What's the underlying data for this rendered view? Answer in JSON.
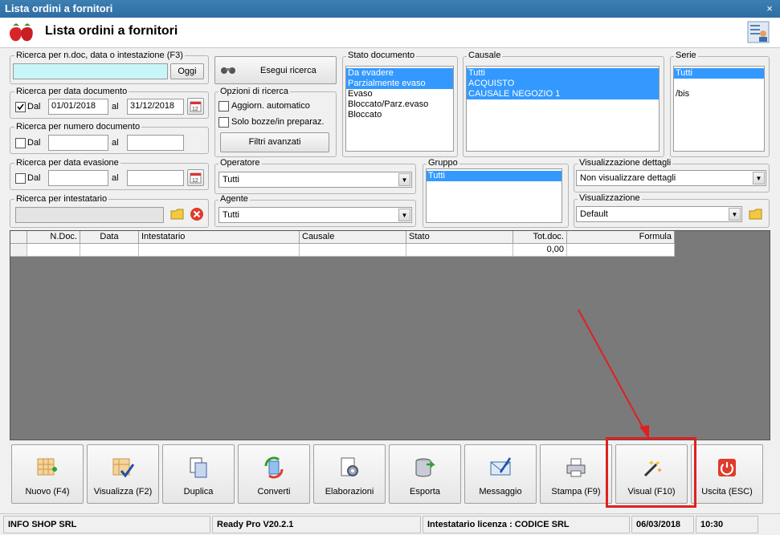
{
  "window": {
    "title": "Lista ordini a fornitori",
    "close": "×"
  },
  "header": {
    "title": "Lista ordini a fornitori"
  },
  "search_ndoc": {
    "label": "Ricerca per n.doc, data o intestazione (F3)",
    "value": "",
    "today_button": "Oggi"
  },
  "search_button": "Esegui ricerca",
  "search_date": {
    "label": "Ricerca per data documento",
    "checked": true,
    "dal_label": "Dal",
    "from": "01/01/2018",
    "al_label": "al",
    "to": "31/12/2018"
  },
  "search_number": {
    "label": "Ricerca per numero documento",
    "dal_label": "Dal",
    "al_label": "al",
    "from": "",
    "to": ""
  },
  "search_evasion": {
    "label": "Ricerca per data evasione",
    "dal_label": "Dal",
    "al_label": "al",
    "from": "",
    "to": ""
  },
  "search_holder": {
    "label": "Ricerca per intestatario",
    "value": ""
  },
  "options": {
    "label": "Opzioni di ricerca",
    "auto_refresh": "Aggiorn. automatico",
    "drafts_only": "Solo bozze/in preparaz.",
    "advanced_filters": "Filtri avanzati"
  },
  "stato": {
    "label": "Stato documento",
    "items": [
      {
        "text": "Da evadere",
        "selected": true
      },
      {
        "text": "Parzialmente evaso",
        "selected": true
      },
      {
        "text": "Evaso",
        "selected": false
      },
      {
        "text": "Bloccato/Parz.evaso",
        "selected": false
      },
      {
        "text": "Bloccato",
        "selected": false
      }
    ]
  },
  "causale": {
    "label": "Causale",
    "items": [
      {
        "text": "Tutti",
        "selected": true
      },
      {
        "text": "ACQUISTO",
        "selected": true
      },
      {
        "text": "CAUSALE NEGOZIO 1",
        "selected": true
      }
    ]
  },
  "serie": {
    "label": "Serie",
    "items": [
      {
        "text": "Tutti",
        "selected": true
      },
      {
        "text": "",
        "selected": false
      },
      {
        "text": "/bis",
        "selected": false
      }
    ]
  },
  "operatore": {
    "label": "Operatore",
    "value": "Tutti"
  },
  "agente": {
    "label": "Agente",
    "value": "Tutti"
  },
  "gruppo": {
    "label": "Gruppo",
    "items": [
      {
        "text": "Tutti",
        "selected": true
      }
    ]
  },
  "vis_dettagli": {
    "label": "Visualizzazione dettagli",
    "value": "Non visualizzare dettagli"
  },
  "visualizzazione": {
    "label": "Visualizzazione",
    "value": "Default"
  },
  "table": {
    "columns": [
      "",
      "N.Doc.",
      "Data",
      "Intestatario",
      "Causale",
      "Stato",
      "Tot.doc.",
      "Formula"
    ],
    "total": "0,00"
  },
  "toolbar": [
    "Nuovo (F4)",
    "Visualizza (F2)",
    "Duplica",
    "Converti",
    "Elaborazioni",
    "Esporta",
    "Messaggio",
    "Stampa (F9)",
    "Visual (F10)",
    "Uscita (ESC)"
  ],
  "status": {
    "company": "INFO SHOP SRL",
    "version": "Ready Pro V20.2.1",
    "license": "Intestatario licenza : CODICE SRL",
    "date": "06/03/2018",
    "time": "10:30"
  },
  "colors": {
    "titlebar": "#2e6da4",
    "selection": "#3399ff",
    "highlight": "#e02020"
  }
}
